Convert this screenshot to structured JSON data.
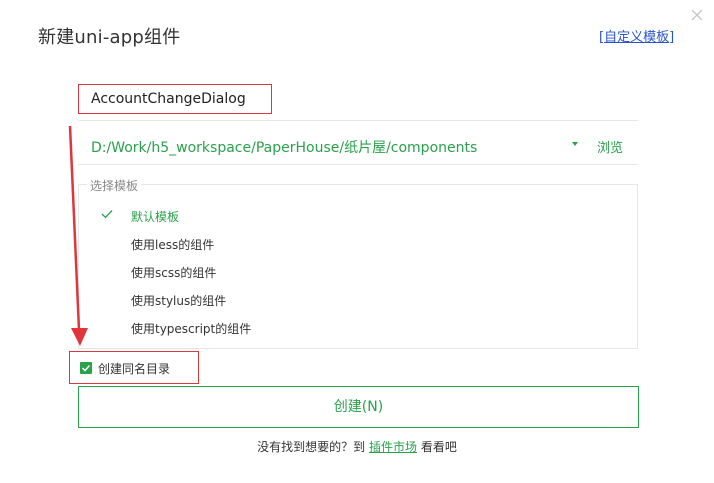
{
  "window": {
    "title": "新建uni-app组件",
    "custom_template_open": "[",
    "custom_template_link": "自定义模板",
    "custom_template_close": "]"
  },
  "name_input": {
    "value": "AccountChangeDialog"
  },
  "path": {
    "value": "D:/Work/h5_workspace/PaperHouse/纸片屋/components",
    "browse_label": "浏览"
  },
  "templates": {
    "legend": "选择模板",
    "items": [
      {
        "label": "默认模板",
        "selected": true
      },
      {
        "label": "使用less的组件",
        "selected": false
      },
      {
        "label": "使用scss的组件",
        "selected": false
      },
      {
        "label": "使用stylus的组件",
        "selected": false
      },
      {
        "label": "使用typescript的组件",
        "selected": false
      }
    ]
  },
  "options": {
    "create_dir_label": "创建同名目录",
    "create_dir_checked": true
  },
  "actions": {
    "create_label": "创建(N)"
  },
  "footer": {
    "prefix": "没有找到想要的？到",
    "market_link": "插件市场",
    "suffix": "看看吧"
  },
  "colors": {
    "accent": "#2aa14b",
    "highlight": "#d9393e",
    "link": "#2a55c8"
  }
}
